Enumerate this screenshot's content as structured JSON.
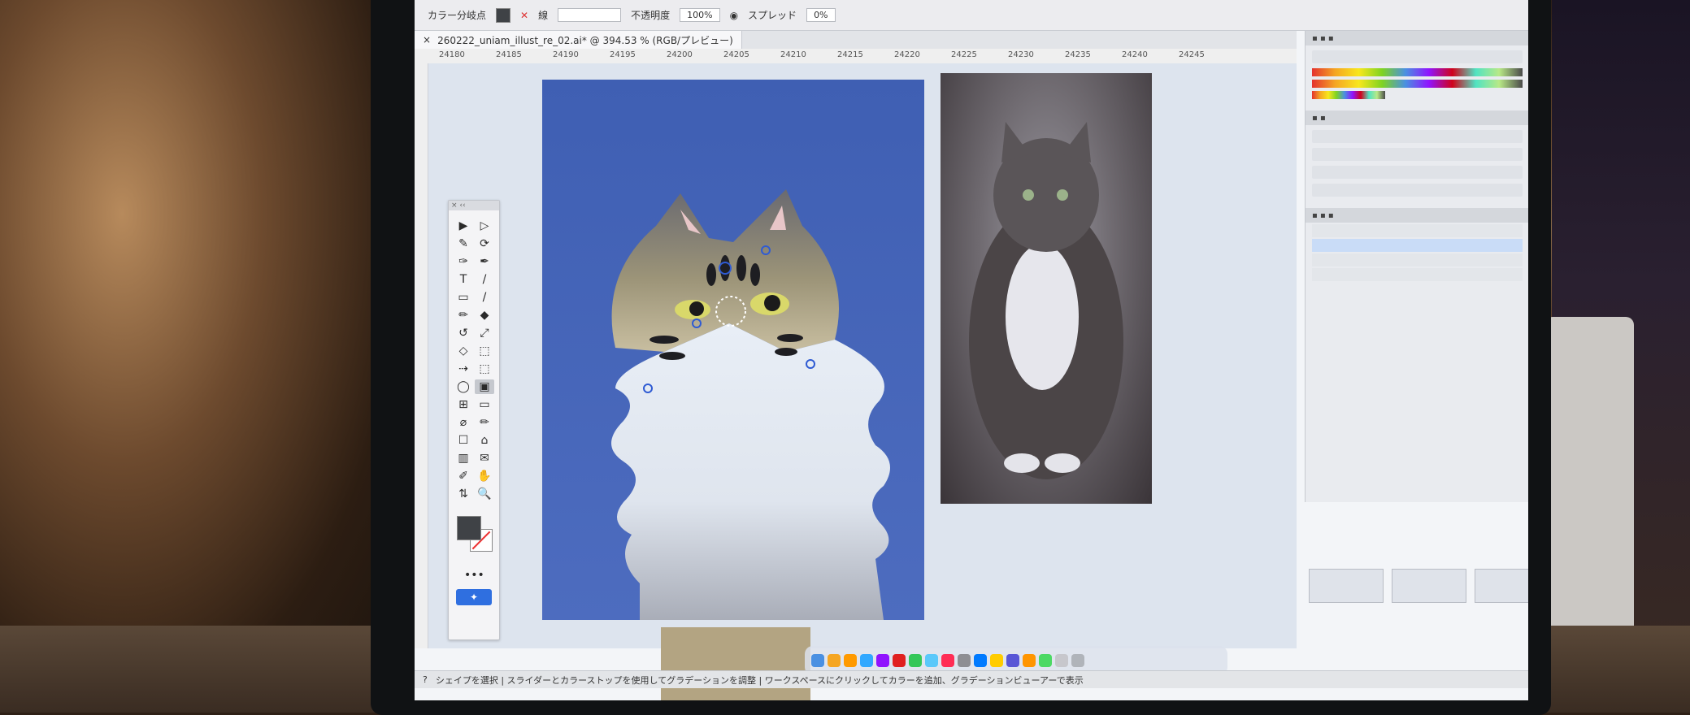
{
  "app": {
    "optbar": {
      "label_compare": "カラー分岐点",
      "label_stroke": "線",
      "label_opacity": "不透明度",
      "opacity_value": "100%",
      "label_spread": "スプレッド",
      "spread_value": "0%"
    },
    "document_tab": {
      "title": "260222_uniam_illust_re_02.ai* @ 394.53 % (RGB/プレビュー)",
      "close": "×"
    },
    "ruler_ticks": [
      "24180",
      "24185",
      "24190",
      "24195",
      "24200",
      "24205",
      "24210",
      "24215",
      "24220",
      "24225",
      "24230",
      "24235",
      "24240",
      "24245"
    ],
    "toolbar_glyphs": [
      "▶",
      "▷",
      "✎",
      "⟳",
      "✑",
      "✒",
      "T",
      "/",
      "▭",
      "/",
      "✏",
      "◆",
      "↺",
      "⤢",
      "◇",
      "⬚",
      "⇢",
      "⬚",
      "◯",
      "▣",
      "⊞",
      "▭",
      "⌀",
      "✏",
      "☐",
      "⌂",
      "▥",
      "✉",
      "✐",
      "✋",
      "⇅",
      "🔍"
    ],
    "toolbar_more": "•••",
    "status_text": "シェイプを選択 | スライダーとカラーストップを使用してグラデーションを調整 | ワークスペースにクリックしてカラーを追加、グラデーションビューアーで表示",
    "thumbs": 4,
    "colors": {
      "artboard_blue": "#4463b6",
      "swatch_tan": "#b3a482",
      "fill_dark": "#3f4246",
      "accent_blue": "#2f6fe0"
    },
    "icons": [
      "pointer-icon",
      "direct-select-icon",
      "pen-icon",
      "type-icon",
      "shape-icon",
      "brush-icon",
      "rotate-icon",
      "scale-icon",
      "gradient-icon",
      "eyedropper-icon",
      "hand-icon",
      "zoom-icon",
      "chart-icon"
    ]
  }
}
